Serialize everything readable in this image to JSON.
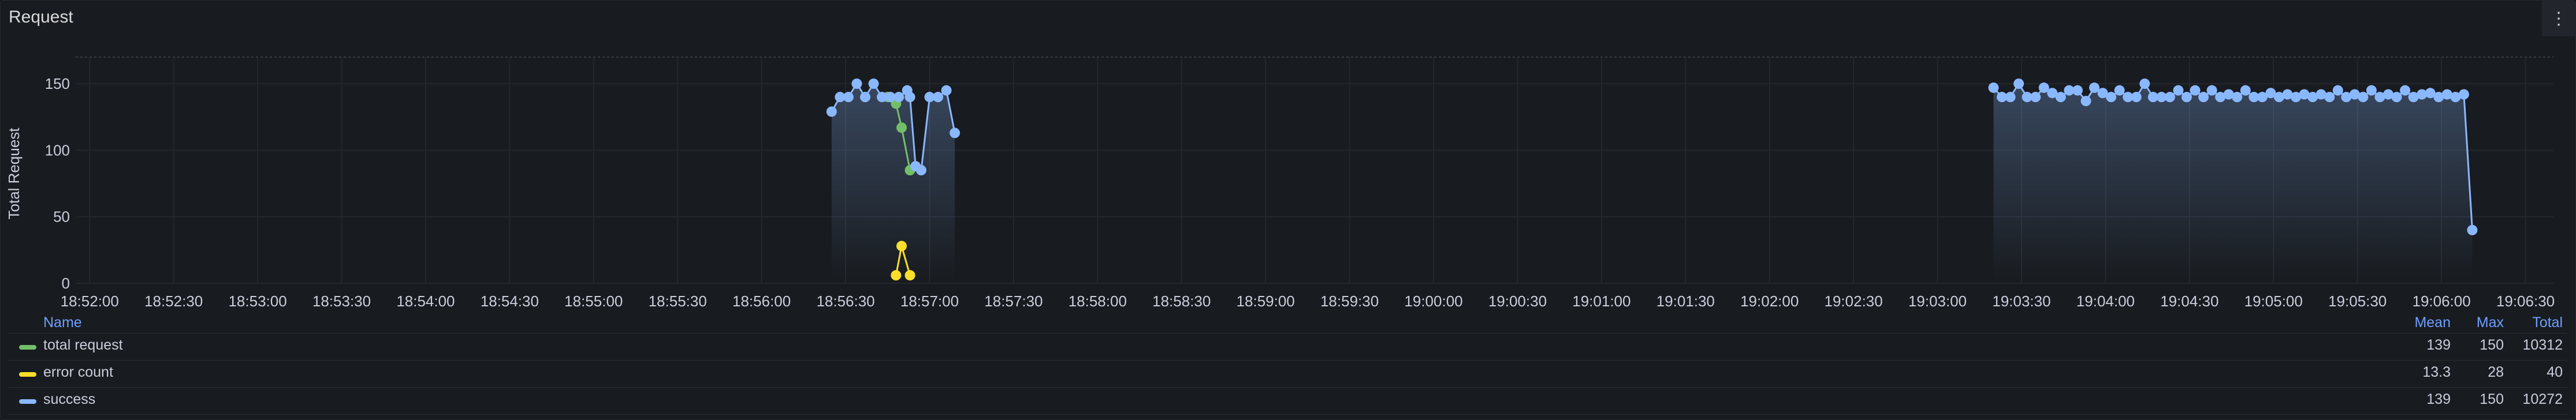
{
  "panel": {
    "title": "Request",
    "menu_icon": "kebab-menu-icon"
  },
  "chart_data": {
    "type": "line",
    "ylabel": "Total Request",
    "ylim": [
      0,
      170
    ],
    "yticks": [
      0,
      50,
      100,
      150
    ],
    "x_tick_labels": [
      "18:52:00",
      "18:52:30",
      "18:53:00",
      "18:53:30",
      "18:54:00",
      "18:54:30",
      "18:55:00",
      "18:55:30",
      "18:56:00",
      "18:56:30",
      "18:57:00",
      "18:57:30",
      "18:58:00",
      "18:58:30",
      "18:59:00",
      "18:59:30",
      "19:00:00",
      "19:00:30",
      "19:01:00",
      "19:01:30",
      "19:02:00",
      "19:02:30",
      "19:03:00",
      "19:03:30",
      "19:04:00",
      "19:04:30",
      "19:05:00",
      "19:05:30",
      "19:06:00",
      "19:06:30"
    ],
    "x_range": [
      "18:51:55",
      "19:06:40"
    ],
    "grid": true,
    "legend_placement": "bottom",
    "series": [
      {
        "name": "total request",
        "color": "#73bf69",
        "points": [
          [
            "18:56:45",
            140
          ],
          [
            "18:56:48",
            135
          ],
          [
            "18:56:50",
            117
          ],
          [
            "18:56:53",
            85
          ]
        ]
      },
      {
        "name": "error count",
        "color": "#fade2a",
        "points": [
          [
            "18:56:48",
            6
          ],
          [
            "18:56:50",
            28
          ],
          [
            "18:56:53",
            6
          ]
        ]
      },
      {
        "name": "success",
        "color": "#8ab8ff",
        "segments": [
          [
            [
              "18:56:25",
              129
            ],
            [
              "18:56:28",
              140
            ],
            [
              "18:56:31",
              140
            ],
            [
              "18:56:34",
              150
            ],
            [
              "18:56:37",
              140
            ],
            [
              "18:56:40",
              150
            ],
            [
              "18:56:43",
              140
            ],
            [
              "18:56:46",
              140
            ],
            [
              "18:56:49",
              140
            ],
            [
              "18:56:52",
              145
            ],
            [
              "18:56:53",
              140
            ],
            [
              "18:56:55",
              88
            ],
            [
              "18:56:57",
              85
            ],
            [
              "18:57:00",
              140
            ],
            [
              "18:57:03",
              140
            ],
            [
              "18:57:06",
              145
            ],
            [
              "18:57:09",
              113
            ]
          ],
          [
            [
              "19:03:20",
              147
            ],
            [
              "19:03:23",
              140
            ],
            [
              "19:03:26",
              140
            ],
            [
              "19:03:29",
              150
            ],
            [
              "19:03:32",
              140
            ],
            [
              "19:03:35",
              140
            ],
            [
              "19:03:38",
              147
            ],
            [
              "19:03:41",
              143
            ],
            [
              "19:03:44",
              140
            ],
            [
              "19:03:47",
              145
            ],
            [
              "19:03:50",
              145
            ],
            [
              "19:03:53",
              137
            ],
            [
              "19:03:56",
              147
            ],
            [
              "19:03:59",
              143
            ],
            [
              "19:04:02",
              140
            ],
            [
              "19:04:05",
              145
            ],
            [
              "19:04:08",
              140
            ],
            [
              "19:04:11",
              140
            ],
            [
              "19:04:14",
              150
            ],
            [
              "19:04:17",
              140
            ],
            [
              "19:04:20",
              140
            ],
            [
              "19:04:23",
              140
            ],
            [
              "19:04:26",
              145
            ],
            [
              "19:04:29",
              140
            ],
            [
              "19:04:32",
              145
            ],
            [
              "19:04:35",
              140
            ],
            [
              "19:04:38",
              145
            ],
            [
              "19:04:41",
              140
            ],
            [
              "19:04:44",
              142
            ],
            [
              "19:04:47",
              140
            ],
            [
              "19:04:50",
              145
            ],
            [
              "19:04:53",
              140
            ],
            [
              "19:04:56",
              140
            ],
            [
              "19:04:59",
              143
            ],
            [
              "19:05:02",
              140
            ],
            [
              "19:05:05",
              142
            ],
            [
              "19:05:08",
              140
            ],
            [
              "19:05:11",
              142
            ],
            [
              "19:05:14",
              140
            ],
            [
              "19:05:17",
              142
            ],
            [
              "19:05:20",
              140
            ],
            [
              "19:05:23",
              145
            ],
            [
              "19:05:26",
              140
            ],
            [
              "19:05:29",
              142
            ],
            [
              "19:05:32",
              140
            ],
            [
              "19:05:35",
              145
            ],
            [
              "19:05:38",
              140
            ],
            [
              "19:05:41",
              142
            ],
            [
              "19:05:44",
              140
            ],
            [
              "19:05:47",
              145
            ],
            [
              "19:05:50",
              140
            ],
            [
              "19:05:53",
              142
            ],
            [
              "19:05:56",
              143
            ],
            [
              "19:05:59",
              140
            ],
            [
              "19:06:02",
              142
            ],
            [
              "19:06:05",
              140
            ],
            [
              "19:06:08",
              142
            ],
            [
              "19:06:11",
              40
            ]
          ]
        ]
      }
    ]
  },
  "legend": {
    "columns": {
      "name": "Name",
      "mean": "Mean",
      "max": "Max",
      "total": "Total"
    },
    "rows": [
      {
        "name": "total request",
        "color": "#73bf69",
        "mean": "139",
        "max": "150",
        "total": "10312"
      },
      {
        "name": "error count",
        "color": "#fade2a",
        "mean": "13.3",
        "max": "28",
        "total": "40"
      },
      {
        "name": "success",
        "color": "#8ab8ff",
        "mean": "139",
        "max": "150",
        "total": "10272"
      }
    ]
  }
}
